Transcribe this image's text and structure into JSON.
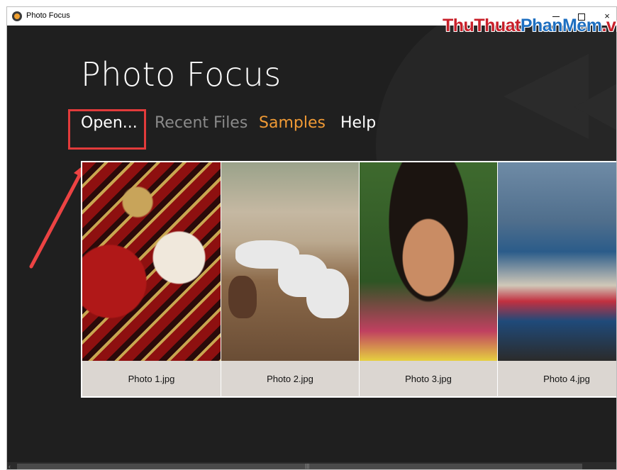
{
  "window": {
    "title": "Photo Focus",
    "controls": {
      "minimize": "minimize",
      "maximize": "maximize",
      "close": "×"
    }
  },
  "watermark": {
    "part1": "ThuThuat",
    "part2": "PhanMem",
    "part3": ".vn"
  },
  "app": {
    "title": "Photo Focus"
  },
  "nav": {
    "items": [
      {
        "label": "Open...",
        "state": "active"
      },
      {
        "label": "Recent Files",
        "state": "disabled"
      },
      {
        "label": "Samples",
        "state": "selected"
      },
      {
        "label": "Help",
        "state": "normal"
      }
    ]
  },
  "gallery": {
    "tiles": [
      {
        "label": "Photo 1.jpg",
        "image": "venetian-mask"
      },
      {
        "label": "Photo 2.jpg",
        "image": "white-horses"
      },
      {
        "label": "Photo 3.jpg",
        "image": "girl-portrait"
      },
      {
        "label": "Photo 4.jpg",
        "image": "fishing-boats"
      }
    ]
  },
  "colors": {
    "background": "#1f1f1f",
    "accent": "#f09a35",
    "highlight": "#e23b3b",
    "muted": "#8a8a8a"
  }
}
